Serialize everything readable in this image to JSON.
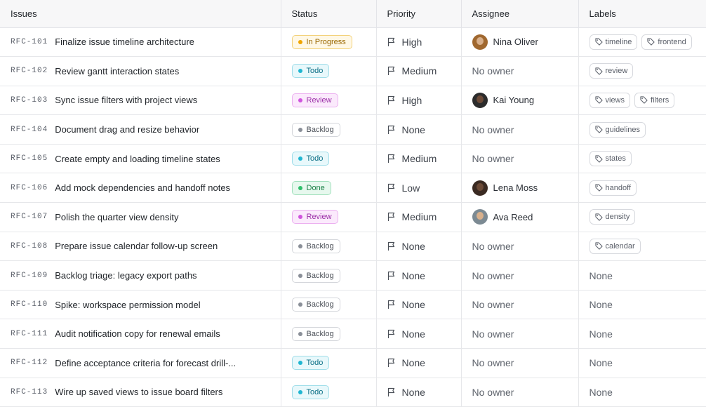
{
  "headers": {
    "issues": "Issues",
    "status": "Status",
    "priority": "Priority",
    "assignee": "Assignee",
    "labels": "Labels"
  },
  "status_styles": {
    "In Progress": {
      "bg": "#fff8e6",
      "border": "#f3d27a",
      "text": "#9a6700",
      "dot": "#f0a500"
    },
    "Todo": {
      "bg": "#e8f8fb",
      "border": "#9fdde9",
      "text": "#0b6f86",
      "dot": "#1fb6d1"
    },
    "Review": {
      "bg": "#fbeafc",
      "border": "#ecb0f0",
      "text": "#9b2ea7",
      "dot": "#d055de"
    },
    "Backlog": {
      "bg": "#ffffff",
      "border": "#d4d6db",
      "text": "#4a4f57",
      "dot": "#8a8f98"
    },
    "Done": {
      "bg": "#e7f8ee",
      "border": "#a2e0bd",
      "text": "#1a7f46",
      "dot": "#2fbf6b"
    }
  },
  "rows": [
    {
      "id": "RFC-101",
      "title": "Finalize issue timeline architecture",
      "status": "In Progress",
      "priority": "High",
      "assignee": "Nina Oliver",
      "avatar_color": "#a0682f",
      "labels": [
        "timeline",
        "frontend"
      ]
    },
    {
      "id": "RFC-102",
      "title": "Review gantt interaction states",
      "status": "Todo",
      "priority": "Medium",
      "assignee": "No owner",
      "avatar_color": null,
      "labels": [
        "review"
      ]
    },
    {
      "id": "RFC-103",
      "title": "Sync issue filters with project views",
      "status": "Review",
      "priority": "High",
      "assignee": "Kai Young",
      "avatar_color": "#2c2c2c",
      "labels": [
        "views",
        "filters"
      ]
    },
    {
      "id": "RFC-104",
      "title": "Document drag and resize behavior",
      "status": "Backlog",
      "priority": "None",
      "assignee": "No owner",
      "avatar_color": null,
      "labels": [
        "guidelines"
      ]
    },
    {
      "id": "RFC-105",
      "title": "Create empty and loading timeline states",
      "status": "Todo",
      "priority": "Medium",
      "assignee": "No owner",
      "avatar_color": null,
      "labels": [
        "states"
      ]
    },
    {
      "id": "RFC-106",
      "title": "Add mock dependencies and handoff notes",
      "status": "Done",
      "priority": "Low",
      "assignee": "Lena Moss",
      "avatar_color": "#3a2a22",
      "labels": [
        "handoff"
      ]
    },
    {
      "id": "RFC-107",
      "title": "Polish the quarter view density",
      "status": "Review",
      "priority": "Medium",
      "assignee": "Ava Reed",
      "avatar_color": "#7c8a93",
      "labels": [
        "density"
      ]
    },
    {
      "id": "RFC-108",
      "title": "Prepare issue calendar follow-up screen",
      "status": "Backlog",
      "priority": "None",
      "assignee": "No owner",
      "avatar_color": null,
      "labels": [
        "calendar"
      ]
    },
    {
      "id": "RFC-109",
      "title": "Backlog triage: legacy export paths",
      "status": "Backlog",
      "priority": "None",
      "assignee": "No owner",
      "avatar_color": null,
      "labels": []
    },
    {
      "id": "RFC-110",
      "title": "Spike: workspace permission model",
      "status": "Backlog",
      "priority": "None",
      "assignee": "No owner",
      "avatar_color": null,
      "labels": []
    },
    {
      "id": "RFC-111",
      "title": "Audit notification copy for renewal emails",
      "status": "Backlog",
      "priority": "None",
      "assignee": "No owner",
      "avatar_color": null,
      "labels": []
    },
    {
      "id": "RFC-112",
      "title": "Define acceptance criteria for forecast drill-...",
      "status": "Todo",
      "priority": "None",
      "assignee": "No owner",
      "avatar_color": null,
      "labels": []
    },
    {
      "id": "RFC-113",
      "title": "Wire up saved views to issue board filters",
      "status": "Todo",
      "priority": "None",
      "assignee": "No owner",
      "avatar_color": null,
      "labels": []
    }
  ],
  "empty_labels_text": "None"
}
